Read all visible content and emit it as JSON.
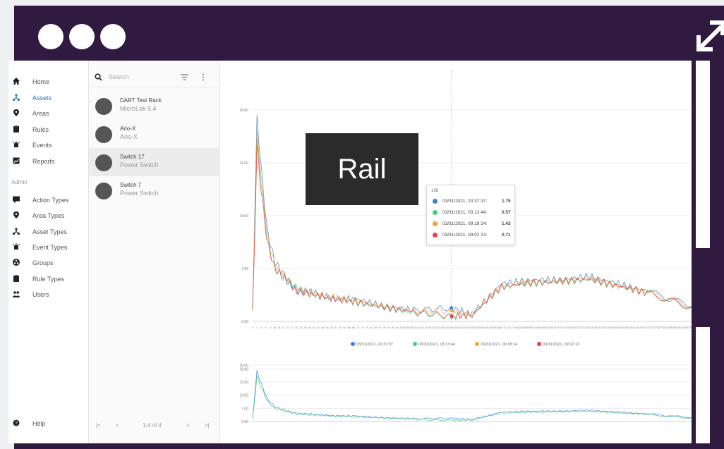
{
  "window": {
    "controls": [
      "close-dot",
      "minimize-dot",
      "maximize-dot"
    ],
    "expand_icon": "expand-diagonal-icon",
    "frame_color": "#301a40"
  },
  "nav": {
    "items": [
      {
        "label": "Home",
        "icon": "home-icon"
      },
      {
        "label": "Assets",
        "icon": "asset-tree-icon",
        "active": true
      },
      {
        "label": "Areas",
        "icon": "map-pin-icon"
      },
      {
        "label": "Rules",
        "icon": "clipboard-icon"
      },
      {
        "label": "Events",
        "icon": "alarm-icon"
      },
      {
        "label": "Reports",
        "icon": "report-icon"
      }
    ],
    "admin_heading": "Admin",
    "admin_items": [
      {
        "label": "Action Types",
        "icon": "action-icon"
      },
      {
        "label": "Area Types",
        "icon": "map-pin-icon"
      },
      {
        "label": "Asset Types",
        "icon": "asset-tree-icon"
      },
      {
        "label": "Event Types",
        "icon": "alarm-icon"
      },
      {
        "label": "Groups",
        "icon": "groups-icon"
      },
      {
        "label": "Rule Types",
        "icon": "clipboard-icon"
      },
      {
        "label": "Users",
        "icon": "users-icon"
      }
    ],
    "help_label": "Help",
    "accent": "#2b6fc7"
  },
  "assets_panel": {
    "search_placeholder": "Search",
    "items": [
      {
        "name": "DART Test Rack",
        "type": "MicroLok 5.4"
      },
      {
        "name": "Ario-X",
        "type": "Ario-X"
      },
      {
        "name": "Switch 17",
        "type": "Power Switch",
        "selected": true
      },
      {
        "name": "Switch 7",
        "type": "Power Switch"
      }
    ],
    "pager_label": "1-4 of 4"
  },
  "overlay": {
    "label": "Rail"
  },
  "tooltip": {
    "header": "136",
    "rows": [
      {
        "color": "#3b82d6",
        "timestamp": "03/31/2021, 20:37:37:",
        "value": "1.75"
      },
      {
        "color": "#4cc982",
        "timestamp": "03/31/2021, 03:13:44:",
        "value": "0.57"
      },
      {
        "color": "#f0a53a",
        "timestamp": "03/31/2021, 09:18:14:",
        "value": "1.43"
      },
      {
        "color": "#e2474e",
        "timestamp": "03/31/2021, 09:02:13:",
        "value": "0.71"
      }
    ]
  },
  "chart_data": [
    {
      "type": "line",
      "ylim": [
        0,
        28
      ],
      "yticks": [
        "0.00",
        "7.00",
        "14.00",
        "21.00",
        "28.00"
      ],
      "x": [
        0,
        3,
        6,
        10,
        15,
        22,
        30,
        40,
        55,
        70,
        90,
        110,
        136,
        150,
        170,
        190,
        210,
        230,
        250,
        270,
        300
      ],
      "series": [
        {
          "name": "03/31/2021, 20:37:37",
          "color": "#3b82d6",
          "values": [
            2,
            27,
            20,
            12,
            8,
            6,
            4,
            4,
            3,
            3,
            2,
            1.5,
            1.75,
            1,
            5,
            5.5,
            5.5,
            6,
            5,
            4,
            2
          ]
        },
        {
          "name": "03/31/2021, 03:13:44",
          "color": "#4cc982",
          "values": [
            1,
            24,
            18,
            11,
            7,
            5.5,
            4.5,
            3.5,
            3,
            2.5,
            1.8,
            1.2,
            0.57,
            0.8,
            4.5,
            5,
            5.2,
            5.5,
            4.6,
            3.8,
            1.8
          ]
        },
        {
          "name": "03/31/2021, 09:18:14",
          "color": "#f0a53a",
          "values": [
            1.5,
            25,
            19,
            11.5,
            7.5,
            6,
            4.2,
            3.8,
            3.2,
            2.8,
            2,
            1.4,
            1.43,
            0.9,
            4.8,
            5.3,
            5.4,
            5.8,
            4.8,
            3.9,
            2
          ]
        },
        {
          "name": "03/31/2021, 09:02:13",
          "color": "#e2474e",
          "values": [
            1.2,
            23,
            17,
            10.5,
            7,
            5.8,
            4,
            3.6,
            3,
            2.6,
            1.9,
            1.3,
            0.71,
            0.85,
            4.6,
            5.1,
            5.3,
            5.6,
            4.7,
            3.7,
            1.9
          ]
        }
      ]
    },
    {
      "type": "line",
      "ylim": [
        0,
        30
      ],
      "yticks": [
        "0.00",
        "7.00",
        "14.00",
        "21.00",
        "28.00",
        "30.00"
      ],
      "x": [
        0,
        3,
        6,
        10,
        15,
        22,
        30,
        40,
        55,
        70,
        90,
        110,
        136,
        150,
        170,
        190,
        210,
        230,
        250,
        270,
        300
      ],
      "series": [
        {
          "name": "03/31/2021, 20:37:37",
          "color": "#3b82d6",
          "values": [
            2,
            27,
            20,
            12,
            8,
            6,
            4,
            4,
            3,
            3,
            2,
            1.5,
            1.75,
            1,
            5,
            5.5,
            5.5,
            6,
            5,
            4,
            2
          ]
        },
        {
          "name": "03/31/2021, 03:13:44",
          "color": "#4cc982",
          "values": [
            1,
            24,
            18,
            11,
            7,
            5.5,
            4.5,
            3.5,
            3,
            2.5,
            1.8,
            1.2,
            0.57,
            0.8,
            4.5,
            5,
            5.2,
            5.5,
            4.6,
            3.8,
            1.8
          ]
        }
      ]
    }
  ]
}
